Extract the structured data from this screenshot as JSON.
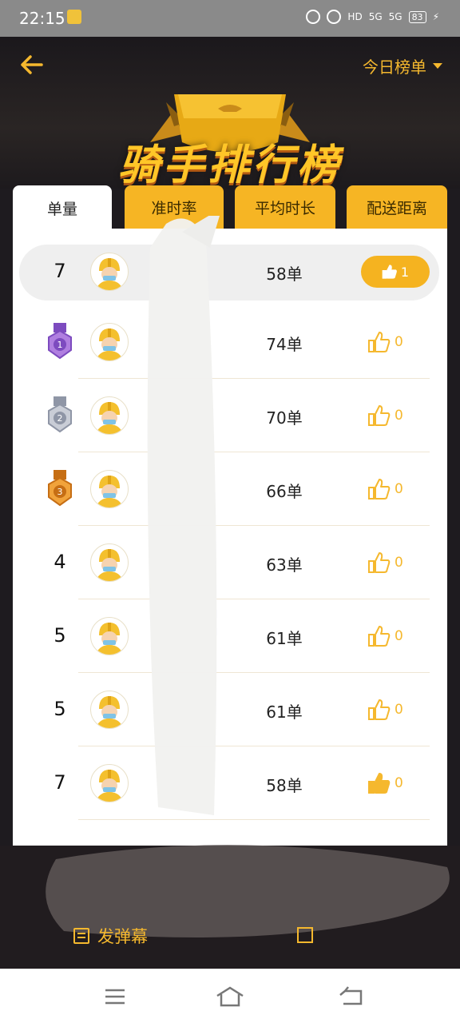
{
  "status_bar": {
    "time": "22:15",
    "network_hd": "HD",
    "signal1": "5G",
    "signal2": "5G",
    "battery": "83"
  },
  "header": {
    "title": "骑手排行榜",
    "ranking_select": "今日榜单"
  },
  "tabs": [
    {
      "label": "单量",
      "active": true
    },
    {
      "label": "准时率",
      "active": false
    },
    {
      "label": "平均时长",
      "active": false
    },
    {
      "label": "配送距离",
      "active": false
    }
  ],
  "list": [
    {
      "rank": "7",
      "medal": null,
      "count": "58单",
      "likes": "1",
      "highlight": true,
      "like_style": "pill"
    },
    {
      "rank": "1",
      "medal": "gold-purple",
      "count": "74单",
      "likes": "0",
      "highlight": false,
      "like_style": "outline"
    },
    {
      "rank": "2",
      "medal": "silver",
      "count": "70单",
      "likes": "0",
      "highlight": false,
      "like_style": "outline"
    },
    {
      "rank": "3",
      "medal": "bronze",
      "count": "66单",
      "likes": "0",
      "highlight": false,
      "like_style": "outline"
    },
    {
      "rank": "4",
      "medal": null,
      "count": "63单",
      "likes": "0",
      "highlight": false,
      "like_style": "outline"
    },
    {
      "rank": "5",
      "medal": null,
      "count": "61单",
      "likes": "0",
      "highlight": false,
      "like_style": "outline"
    },
    {
      "rank": "5",
      "medal": null,
      "count": "61单",
      "likes": "0",
      "highlight": false,
      "like_style": "outline"
    },
    {
      "rank": "7",
      "medal": null,
      "count": "58单",
      "likes": "0",
      "highlight": false,
      "like_style": "filled"
    }
  ],
  "bottom": {
    "danmu_label": "发弹幕"
  },
  "colors": {
    "accent": "#f5b82e",
    "tab_bg": "#f6b524",
    "panel": "#ffffff",
    "dark_bg": "#1e1b1f"
  }
}
